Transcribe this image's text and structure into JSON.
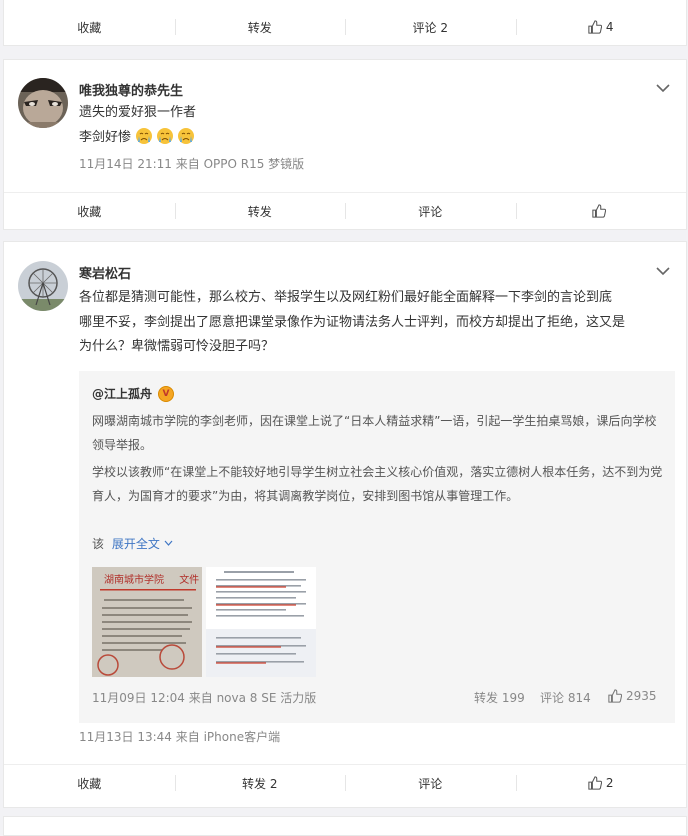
{
  "post1": {
    "actions": {
      "collect": "收藏",
      "forward": "转发",
      "comment": "评论 2",
      "like": "4"
    }
  },
  "post2": {
    "username": "唯我独尊的恭先生",
    "line1": "遗失的爱好狠一作者",
    "line2": "李剑好惨",
    "emojis": [
      "crying-face-icon",
      "crying-face-icon",
      "crying-face-icon"
    ],
    "meta": "11月14日 21:11  来自 OPPO R15 梦镜版",
    "actions": {
      "collect": "收藏",
      "forward": "转发",
      "comment": "评论",
      "like": ""
    }
  },
  "post3": {
    "username": "寒岩松石",
    "lines": [
      "各位都是猜测可能性，那么校方、举报学生以及网红粉们最好能全面解释一下李剑的言论到底",
      "哪里不妥，李剑提出了愿意把课堂录像作为证物请法务人士评判，而校方却提出了拒绝，这又是",
      "为什么？卑微懦弱可怜没胆子吗？"
    ],
    "quote": {
      "author": "@江上孤舟",
      "verified_badge": "V",
      "lines": [
        "网曝湖南城市学院的李剑老师，因在课堂上说了“日本人精益求精”一语，引起一学生拍桌骂娘，课后向学校",
        "领导举报。",
        "学校以该教师“在课堂上不能较好地引导学生树立社会主义核心价值观，落实立德树人根本任务，达不到为党",
        "育人，为国育才的要求”为由，将其调离教学岗位，安排到图书馆从事管理工作。"
      ],
      "more_prefix": "该",
      "more_link": "展开全文",
      "doc_header": "湖南城市学院",
      "doc_suffix": "文件",
      "meta": "11月09日 12:04  来自 nova 8 SE 活力版",
      "forward": "转发 199",
      "comment": "评论 814",
      "like": "2935"
    },
    "meta": "11月13日 13:44  来自 iPhone客户端",
    "actions": {
      "collect": "收藏",
      "forward": "转发 2",
      "comment": "评论",
      "like": "2"
    }
  }
}
